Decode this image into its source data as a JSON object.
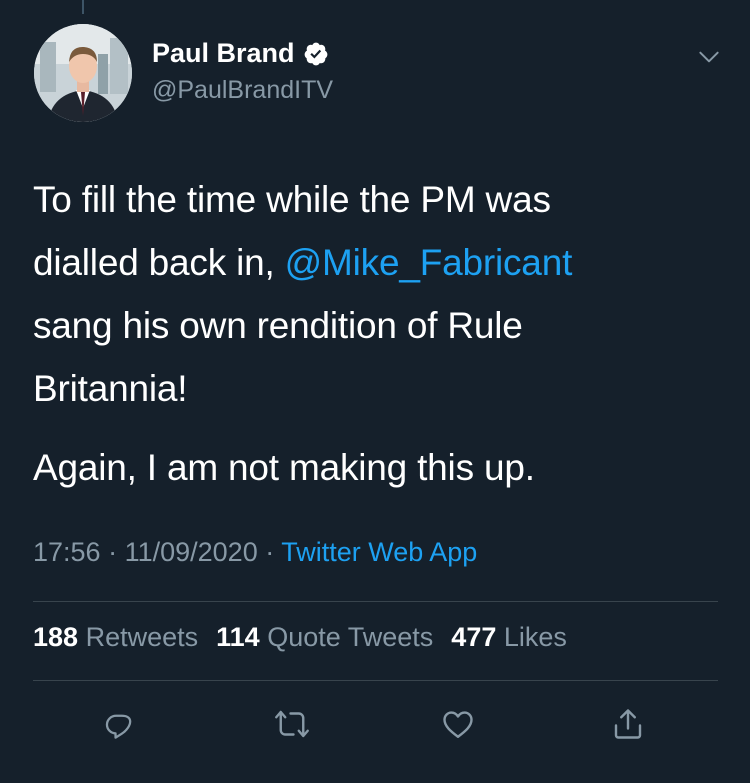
{
  "tweet": {
    "author": {
      "name": "Paul Brand",
      "handle": "@PaulBrandITV",
      "verified": true
    },
    "text": {
      "line1": "To fill the time while the PM was",
      "line2_prefix": "dialled back in, ",
      "mention": "@Mike_Fabricant",
      "line3": "sang his own rendition of Rule",
      "line4": "Britannia!",
      "paragraph2": "Again, I am not making this up."
    },
    "meta": {
      "time": "17:56",
      "separator1": " · ",
      "date": "11/09/2020",
      "separator2": " · ",
      "app": "Twitter Web App"
    },
    "stats": {
      "retweets_count": "188",
      "retweets_label": " Retweets",
      "quotes_count": "114",
      "quotes_label": " Quote Tweets",
      "likes_count": "477",
      "likes_label": " Likes"
    }
  },
  "colors": {
    "background": "#15202b",
    "text": "#ffffff",
    "secondary_text": "#8899a6",
    "accent": "#1da1f2",
    "divider": "#38444d"
  },
  "icons": {
    "reply": "reply-icon",
    "retweet": "retweet-icon",
    "like": "heart-icon",
    "share": "share-icon",
    "more": "chevron-down-icon",
    "verified": "verified-badge-icon"
  }
}
